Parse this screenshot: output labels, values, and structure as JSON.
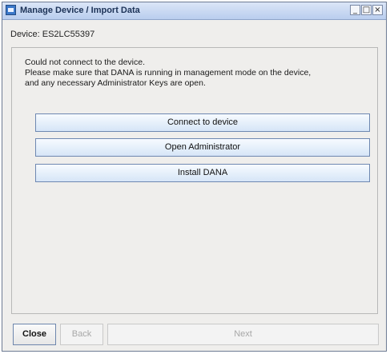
{
  "window": {
    "title": "Manage Device / Import Data",
    "buttons": [
      "_",
      "□",
      "×"
    ]
  },
  "device": {
    "label": "Device:",
    "id": "ES2LC55397"
  },
  "message": {
    "line1": "Could not connect to the device.",
    "line2": "Please make sure that DANA is running in management mode on the device,",
    "line3": "and any necessary Administrator Keys are open."
  },
  "actions": {
    "connect": "Connect to device",
    "open_admin": "Open Administrator",
    "install": "Install DANA"
  },
  "footer": {
    "close": "Close",
    "back": "Back",
    "next": "Next"
  }
}
